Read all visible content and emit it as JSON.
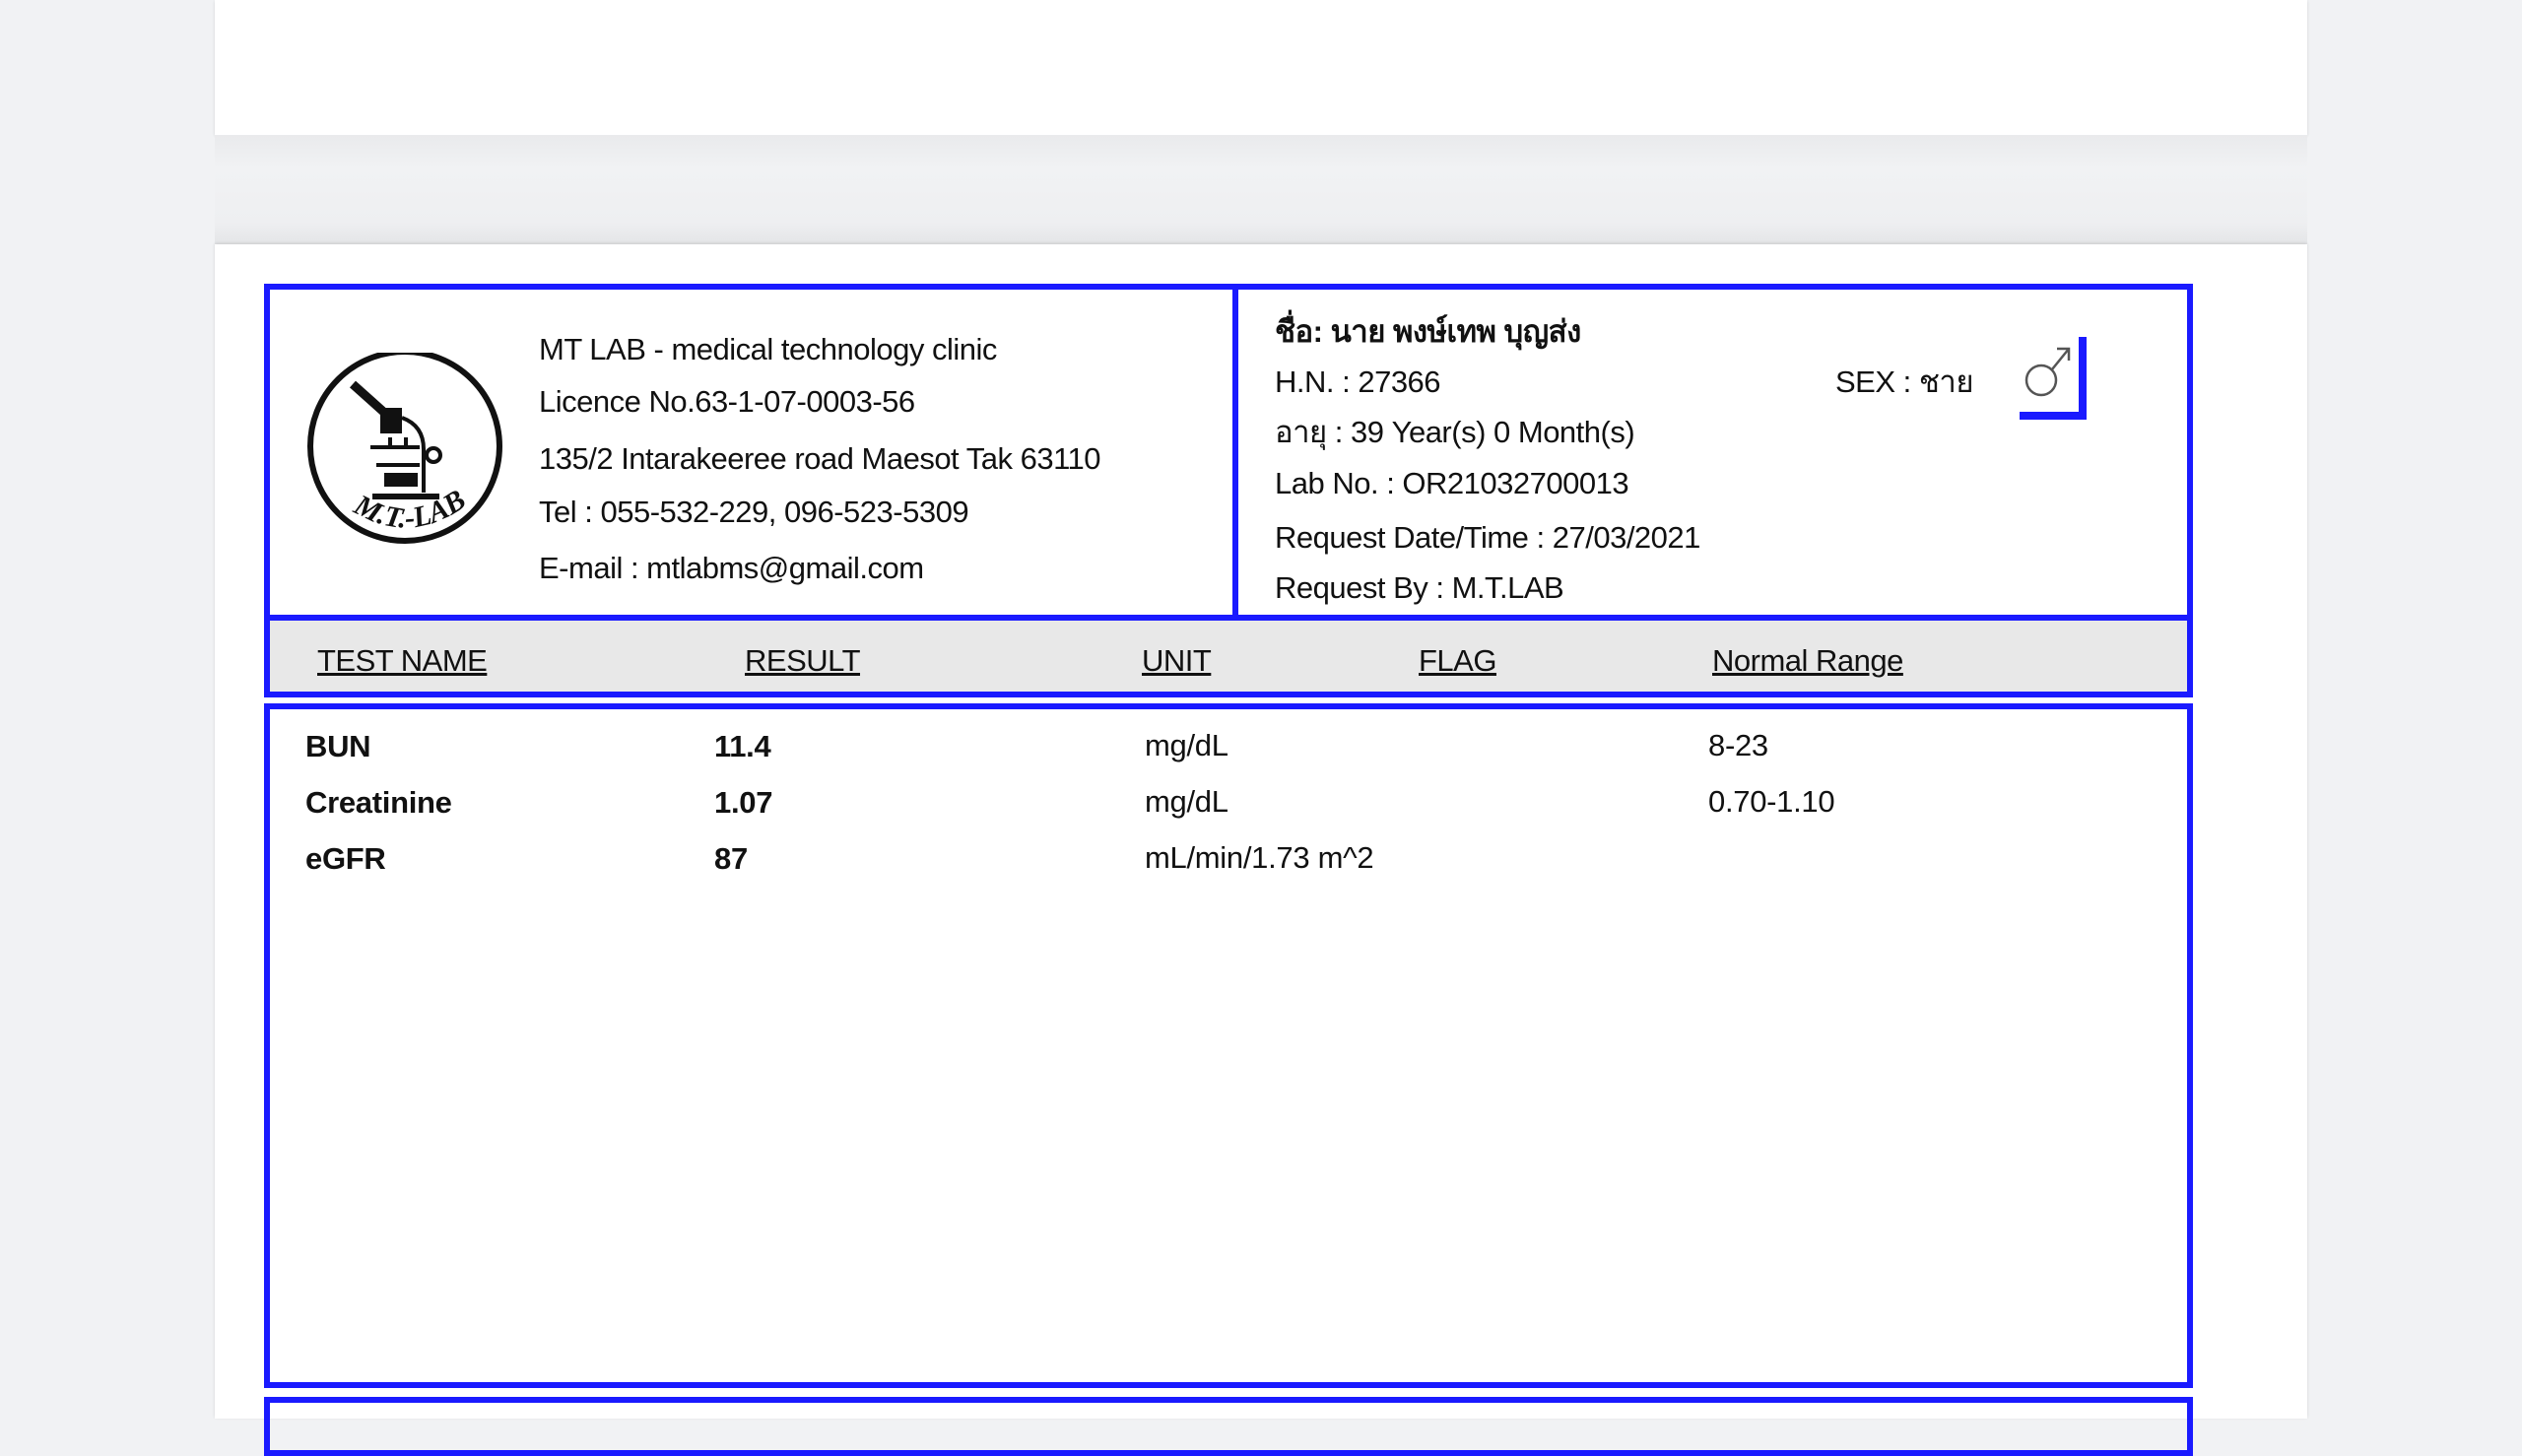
{
  "clinic": {
    "name": "MT LAB - medical technology clinic",
    "licence": "Licence No.63-1-07-0003-56",
    "address": "135/2 Intarakeeree road Maesot Tak 63110",
    "tel": "Tel : 055-532-229, 096-523-5309",
    "email": "E-mail : mtlabms@gmail.com",
    "logo_text": "M.T.-LAB",
    "logo_icon": "microscope-icon"
  },
  "patient": {
    "name": "ชื่อ: นาย พงษ์เทพ บุญส่ง",
    "hn": "H.N. : 27366",
    "age": "อายุ : 39 Year(s) 0 Month(s)",
    "lab_no": "Lab No. : OR21032700013",
    "request_datetime": "Request Date/Time : 27/03/2021",
    "request_by": "Request By : M.T.LAB",
    "sex": "SEX : ชาย",
    "sex_icon": "male-symbol-icon"
  },
  "columns": {
    "test_name": "TEST NAME",
    "result": "RESULT",
    "unit": "UNIT",
    "flag": "FLAG",
    "normal_range": "Normal Range"
  },
  "rows": [
    {
      "test": "BUN",
      "result": "11.4",
      "unit": "mg/dL",
      "flag": "",
      "range": "8-23"
    },
    {
      "test": "Creatinine",
      "result": "1.07",
      "unit": "mg/dL",
      "flag": "",
      "range": "0.70-1.10"
    },
    {
      "test": "eGFR",
      "result": "87",
      "unit": "mL/min/1.73 m^2",
      "flag": "",
      "range": ""
    }
  ],
  "colors": {
    "border": "#1a1aff",
    "header_bg": "#e8e8e8",
    "viewer_bg": "#f1f2f4"
  }
}
